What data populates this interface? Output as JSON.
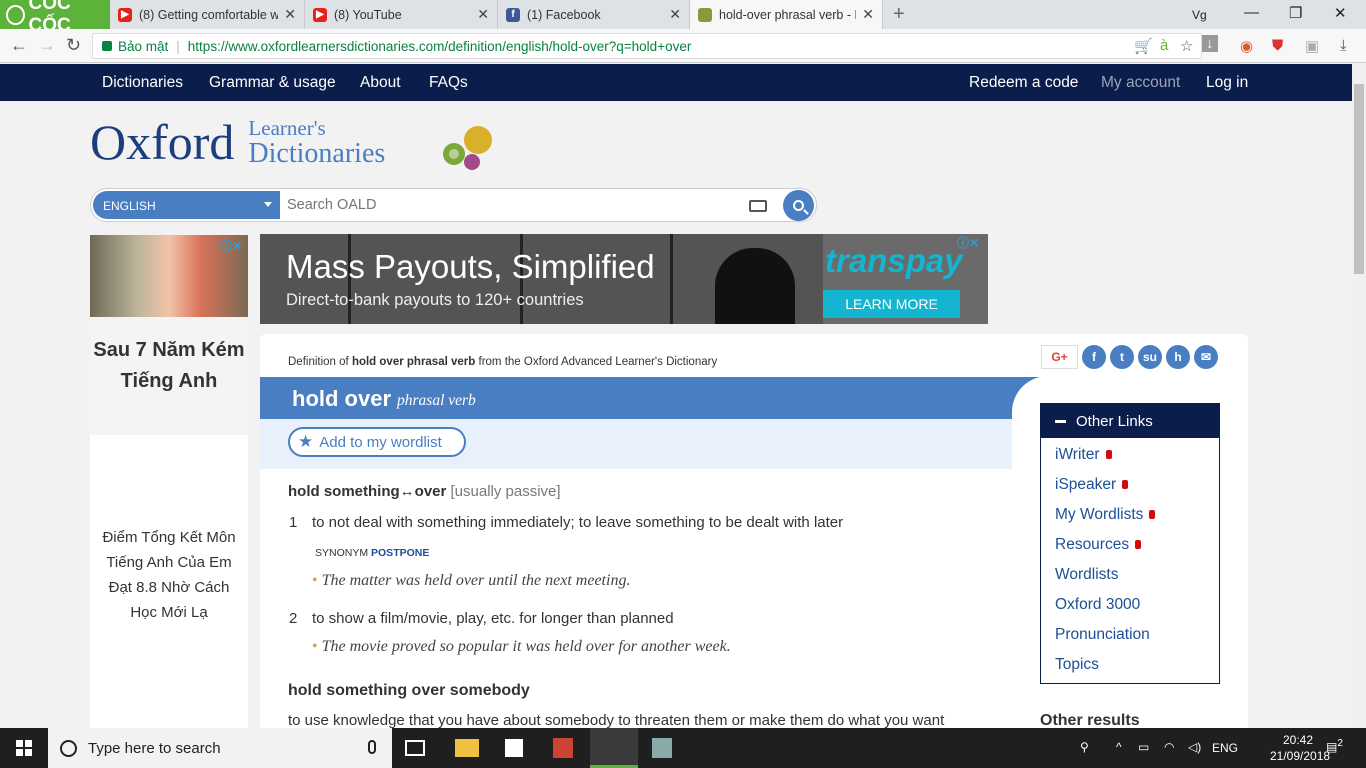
{
  "browser": {
    "brand": "CỐC CỐC",
    "tabs": [
      {
        "label": "(8) Getting comfortable wi",
        "favicon": "youtube-icon"
      },
      {
        "label": "(8) YouTube",
        "favicon": "youtube-icon"
      },
      {
        "label": "(1) Facebook",
        "favicon": "facebook-icon"
      },
      {
        "label": "hold-over phrasal verb - D",
        "favicon": "oxford-icon"
      }
    ],
    "secure_label": "Bảo mật",
    "url": "https://www.oxfordlearnersdictionaries.com/definition/english/hold-over?q=hold+over",
    "translate_glyph": "à"
  },
  "site_nav": {
    "left": [
      "Dictionaries",
      "Grammar & usage",
      "About",
      "FAQs"
    ],
    "redeem": "Redeem a code",
    "account": "My account",
    "login": "Log in"
  },
  "logo": {
    "word": "Oxford",
    "line1": "Learner's",
    "line2": "Dictionaries"
  },
  "search": {
    "language": "ENGLISH",
    "placeholder": "Search OALD"
  },
  "left_ad": {
    "heading": "Sau 7 Năm Kém Tiếng Anh",
    "body": "Điểm Tổng Kết Môn Tiếng Anh Của Em Đạt 8.8 Nhờ Cách Học Mới Lạ"
  },
  "banner": {
    "title": "Mass Payouts, Simplified",
    "subtitle": "Direct-to-bank payouts to 120+ countries",
    "brand": "transpay",
    "cta": "LEARN MORE"
  },
  "definition": {
    "source_prefix": "Definition of",
    "source_term": "hold over phrasal verb",
    "source_suffix": "from the Oxford Advanced Learner's Dictionary",
    "headword": "hold over",
    "pos": "phrasal verb",
    "wordlist": "Add to my wordlist",
    "entry1": {
      "phrase": "hold something↔over",
      "note": "[usually passive]"
    },
    "senses": [
      {
        "num": "1",
        "text": "to not deal with something immediately; to leave something to be dealt with later"
      },
      {
        "num": "2",
        "text": "to show a film/movie, play, etc. for longer than planned"
      }
    ],
    "synonym_label": "SYNONYM",
    "synonym": "POSTPONE",
    "examples": [
      "The matter was held over until the next meeting.",
      "The movie proved so popular it was held over for another week."
    ],
    "entry2": "hold something over somebody",
    "entry2_def": "to use knowledge that you have about somebody to threaten them or make them do what you want"
  },
  "share": {
    "gplus": "G+"
  },
  "other_links": {
    "title": "Other Links",
    "items": [
      "iWriter",
      "iSpeaker",
      "My Wordlists",
      "Resources",
      "Wordlists",
      "Oxford 3000",
      "Pronunciation",
      "Topics"
    ],
    "locked": [
      true,
      true,
      true,
      true,
      false,
      false,
      false,
      false
    ]
  },
  "other_results": "Other results",
  "taskbar": {
    "search_placeholder": "Type here to search",
    "lang": "ENG",
    "time": "20:42",
    "date": "21/09/2018",
    "notifications": "2"
  },
  "colors": {
    "navy": "#0b1d4a",
    "blue": "#4a7ec3",
    "green": "#5cb33a"
  }
}
